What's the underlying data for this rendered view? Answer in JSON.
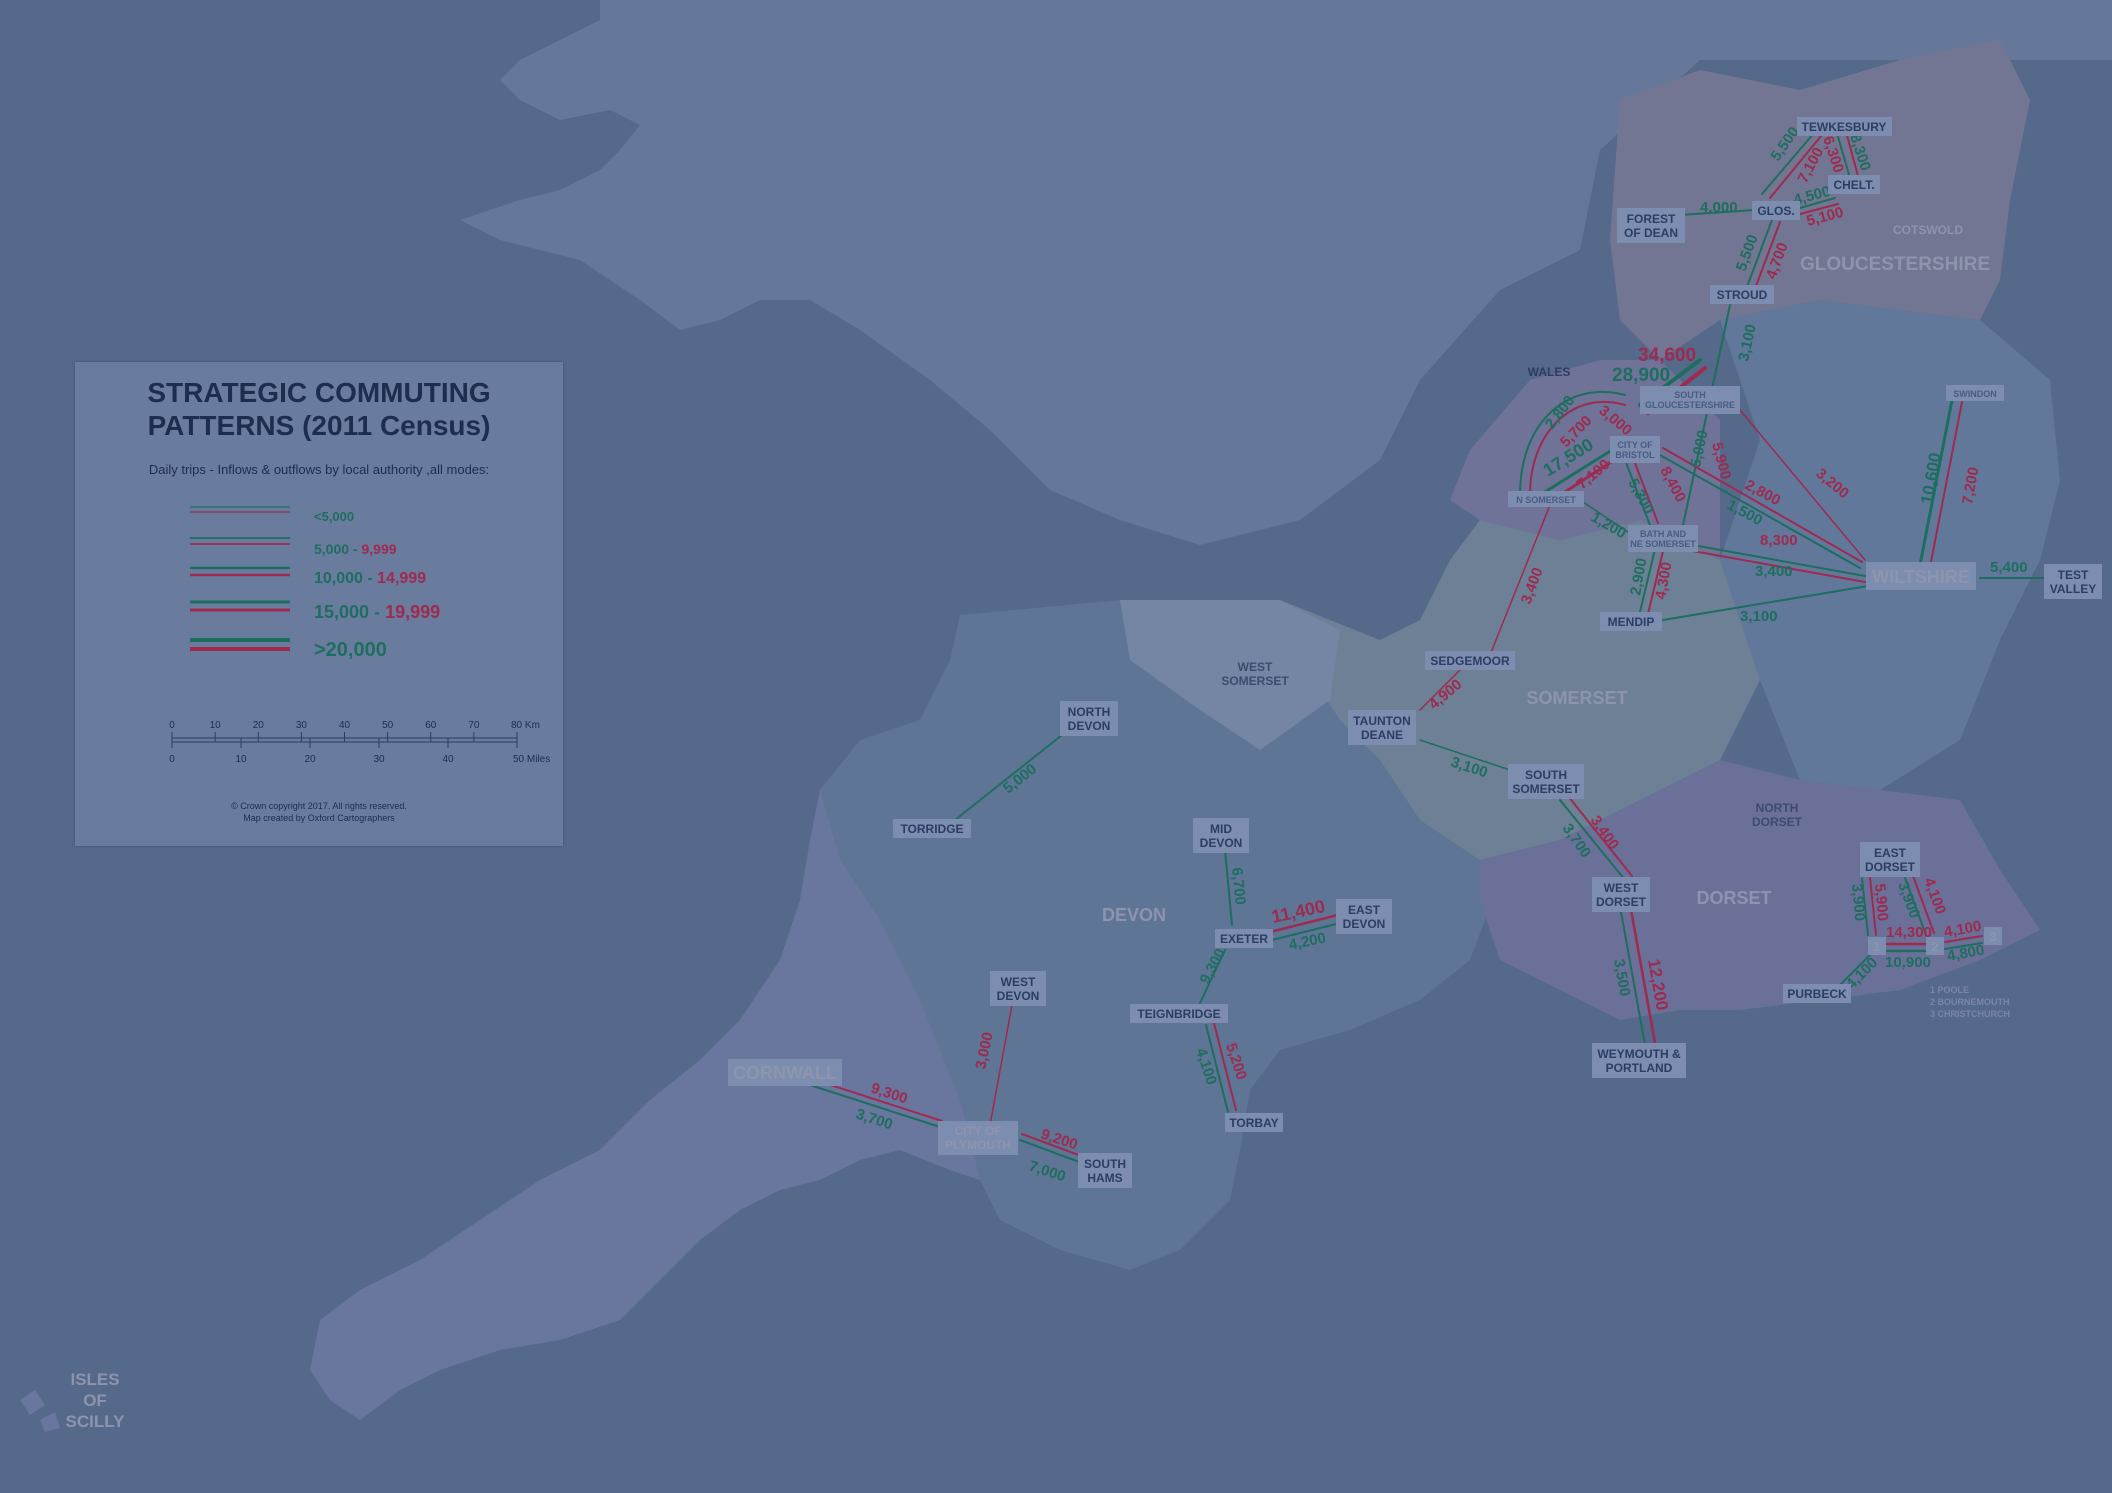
{
  "legend": {
    "title_line1": "STRATEGIC COMMUTING",
    "title_line2": "PATTERNS (2011 Census)",
    "subtitle": "Daily trips - Inflows & outflows by local authority ,all modes:",
    "rows": [
      {
        "green": "<5,000",
        "red": ""
      },
      {
        "green": "5,000 - ",
        "red": "9,999"
      },
      {
        "green": "10,000 - ",
        "red": "14,999"
      },
      {
        "green": "15,000 - ",
        "red": "19,999"
      },
      {
        "green": ">20,000",
        "red": ""
      }
    ],
    "km_ticks": [
      "0",
      "10",
      "20",
      "30",
      "40",
      "50",
      "60",
      "70",
      "80 Km"
    ],
    "mile_ticks": [
      "0",
      "10",
      "20",
      "30",
      "40",
      "50 Miles"
    ],
    "copyright_line1": "© Crown copyright 2017. All rights reserved.",
    "copyright_line2": "Map created by Oxford Cartographers"
  },
  "regions": {
    "gloucestershire": "GLOUCESTERSHIRE",
    "cotswold": "COTSWOLD",
    "somerset": "SOMERSET",
    "west_somerset_1": "WEST",
    "west_somerset_2": "SOMERSET",
    "devon": "DEVON",
    "dorset": "DORSET",
    "north_dorset_1": "NORTH",
    "north_dorset_2": "DORSET",
    "isles_1": "ISLES",
    "isles_2": "OF",
    "isles_3": "SCILLY"
  },
  "places": {
    "tewkesbury": "TEWKESBURY",
    "forest_of_dean_1": "FOREST",
    "forest_of_dean_2": "OF DEAN",
    "glos": "GLOS.",
    "chelt": "CHELT.",
    "stroud": "STROUD",
    "wales": "WALES",
    "south_glos_1": "SOUTH",
    "south_glos_2": "GLOUCESTERSHIRE",
    "city_of_bristol_1": "CITY OF",
    "city_of_bristol_2": "BRISTOL",
    "n_somerset": "N SOMERSET",
    "bath_1": "BATH AND",
    "bath_2": "NE SOMERSET",
    "swindon": "SWINDON",
    "wiltshire": "WILTSHIRE",
    "test_valley_1": "TEST",
    "test_valley_2": "VALLEY",
    "mendip": "MENDIP",
    "sedgemoor": "SEDGEMOOR",
    "taunton_1": "TAUNTON",
    "taunton_2": "DEANE",
    "south_somerset_1": "SOUTH",
    "south_somerset_2": "SOMERSET",
    "north_devon_1": "NORTH",
    "north_devon_2": "DEVON",
    "torridge": "TORRIDGE",
    "mid_devon_1": "MID",
    "mid_devon_2": "DEVON",
    "exeter": "EXETER",
    "east_devon_1": "EAST",
    "east_devon_2": "DEVON",
    "teignbridge": "TEIGNBRIDGE",
    "torbay": "TORBAY",
    "west_devon_1": "WEST",
    "west_devon_2": "DEVON",
    "cornwall": "CORNWALL",
    "plymouth_1": "CITY OF",
    "plymouth_2": "PLYMOUTH",
    "south_hams_1": "SOUTH",
    "south_hams_2": "HAMS",
    "west_dorset_1": "WEST",
    "west_dorset_2": "DORSET",
    "weymouth_1": "WEYMOUTH &",
    "weymouth_2": "PORTLAND",
    "east_dorset_1": "EAST",
    "east_dorset_2": "DORSET",
    "purbeck": "PURBECK",
    "num_1": "1",
    "num_2": "2",
    "num_3": "3",
    "key_1": "1   POOLE",
    "key_2": "2   BOURNEMOUTH",
    "key_3": "3   CHRISTCHURCH"
  },
  "flows": {
    "f5500a": "5,500",
    "f7100": "7,100",
    "f6300": "6,300",
    "f8300a": "8,300",
    "f4000": "4,000",
    "f4500": "4,500",
    "f5100": "5,100",
    "f5500b": "5,500",
    "f4700": "4,700",
    "f3100a": "3,100",
    "f34600": "34,600",
    "f28900": "28,900",
    "f2800a": "2,800",
    "f5700": "5,700",
    "f3000a": "3,000",
    "f17500": "17,500",
    "f7100b": "7,100",
    "f5000a": "5,000",
    "f5900": "5,900",
    "f5300": "5,300",
    "f8400": "8,400",
    "f2800b": "2,800",
    "f1500": "1,500",
    "f8300b": "8,300",
    "f3200": "3,200",
    "f1200": "1,200",
    "f3400a": "3,400",
    "f10600": "10,600",
    "f7200": "7,200",
    "f5400": "5,400",
    "f2900": "2,900",
    "f4300": "4,300",
    "f3100b": "3,100",
    "f3400b": "3,400",
    "f4900": "4,900",
    "f3100c": "3,100",
    "f5000b": "5,000",
    "f6700": "6,700",
    "f11400": "11,400",
    "f4200": "4,200",
    "f9300a": "9,300",
    "f4100a": "4,100",
    "f5200": "5,200",
    "f3000b": "3,000",
    "f9300b": "9,300",
    "f3700": "3,700",
    "f9200": "9,200",
    "f7000": "7,000",
    "f3400c": "3,400",
    "f3700b": "3,700",
    "f12200": "12,200",
    "f3500": "3,500",
    "f3900a": "3,900",
    "f5900b": "5,900",
    "f3900b": "3,900",
    "f4100b": "4,100",
    "f14300": "14,300",
    "f10900": "10,900",
    "f4100c": "4,100",
    "f4800": "4,800",
    "f4100d": "4,100"
  },
  "colors": {
    "sea": "#55698b",
    "land": "#66789a",
    "inflow": "#1e6e5f",
    "outflow": "#9e2a4f",
    "label_box": "#7c8db0",
    "label_text": "#2c3d63"
  }
}
